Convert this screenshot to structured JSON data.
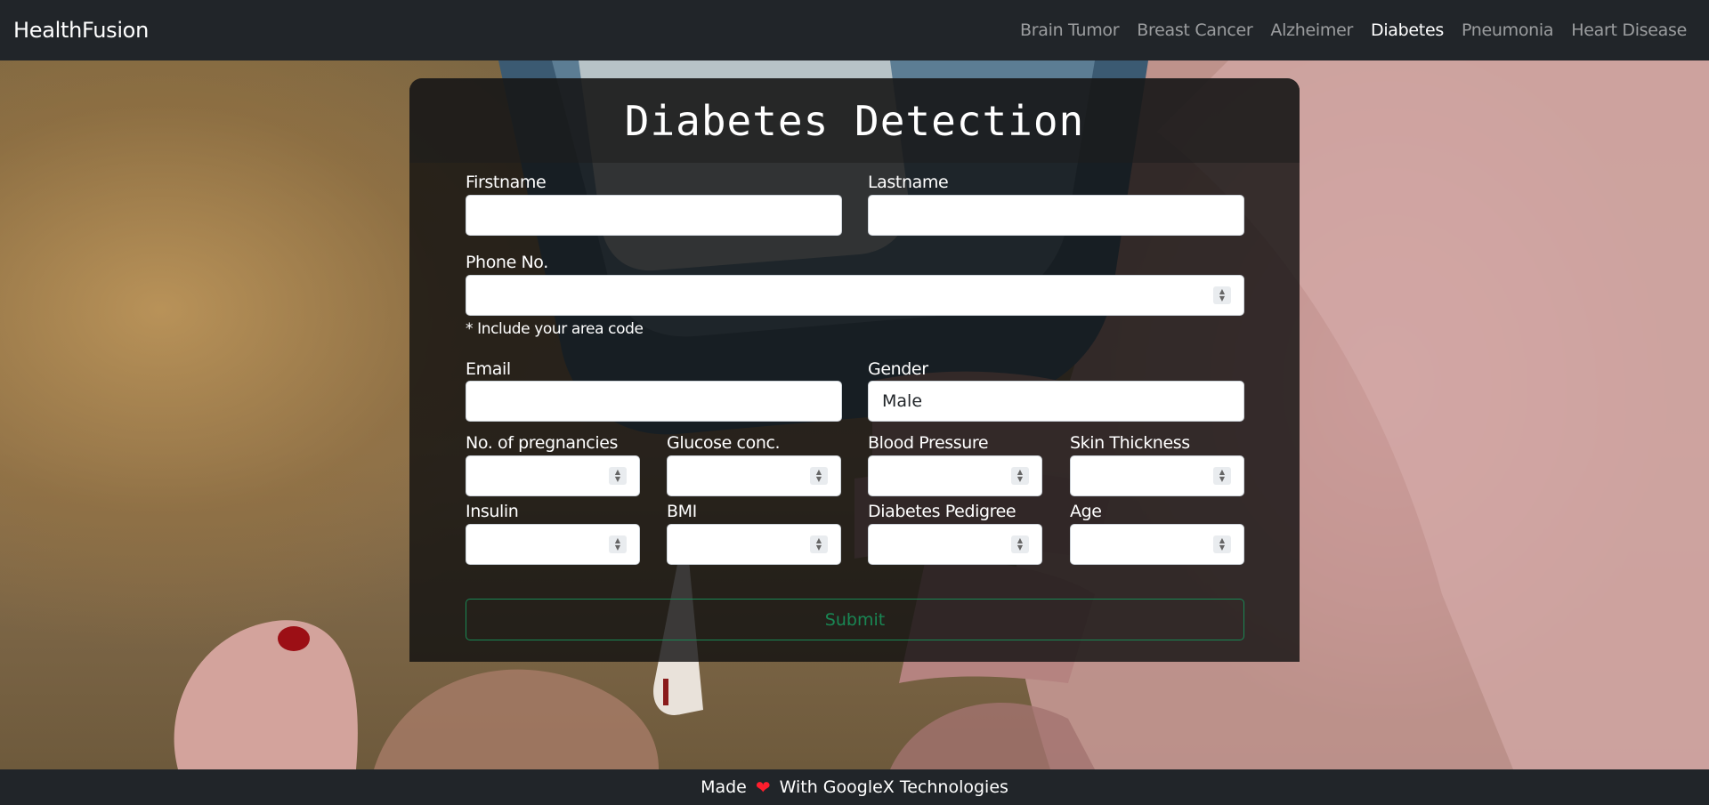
{
  "navbar": {
    "brand": "HealthFusion",
    "links": [
      {
        "label": "Brain Tumor",
        "active": false
      },
      {
        "label": "Breast Cancer",
        "active": false
      },
      {
        "label": "Alzheimer",
        "active": false
      },
      {
        "label": "Diabetes",
        "active": true
      },
      {
        "label": "Pneumonia",
        "active": false
      },
      {
        "label": "Heart Disease",
        "active": false
      }
    ]
  },
  "form": {
    "title": "Diabetes Detection",
    "firstname_label": "Firstname",
    "firstname_value": "",
    "lastname_label": "Lastname",
    "lastname_value": "",
    "phone_label": "Phone No.",
    "phone_value": "",
    "phone_hint": "* Include your area code",
    "email_label": "Email",
    "email_value": "",
    "gender_label": "Gender",
    "gender_value": "Male",
    "pregnancies_label": "No. of pregnancies",
    "glucose_label": "Glucose conc.",
    "blood_pressure_label": "Blood Pressure",
    "skin_thickness_label": "Skin Thickness",
    "insulin_label": "Insulin",
    "bmi_label": "BMI",
    "pedigree_label": "Diabetes Pedigree",
    "age_label": "Age",
    "submit_label": "Submit"
  },
  "footer": {
    "made": "Made",
    "with": "With GoogleX Technologies",
    "heart_icon": "heart-icon"
  },
  "colors": {
    "navbar_bg": "#212529",
    "submit_accent": "#198754",
    "heart": "#ff1e2d"
  }
}
